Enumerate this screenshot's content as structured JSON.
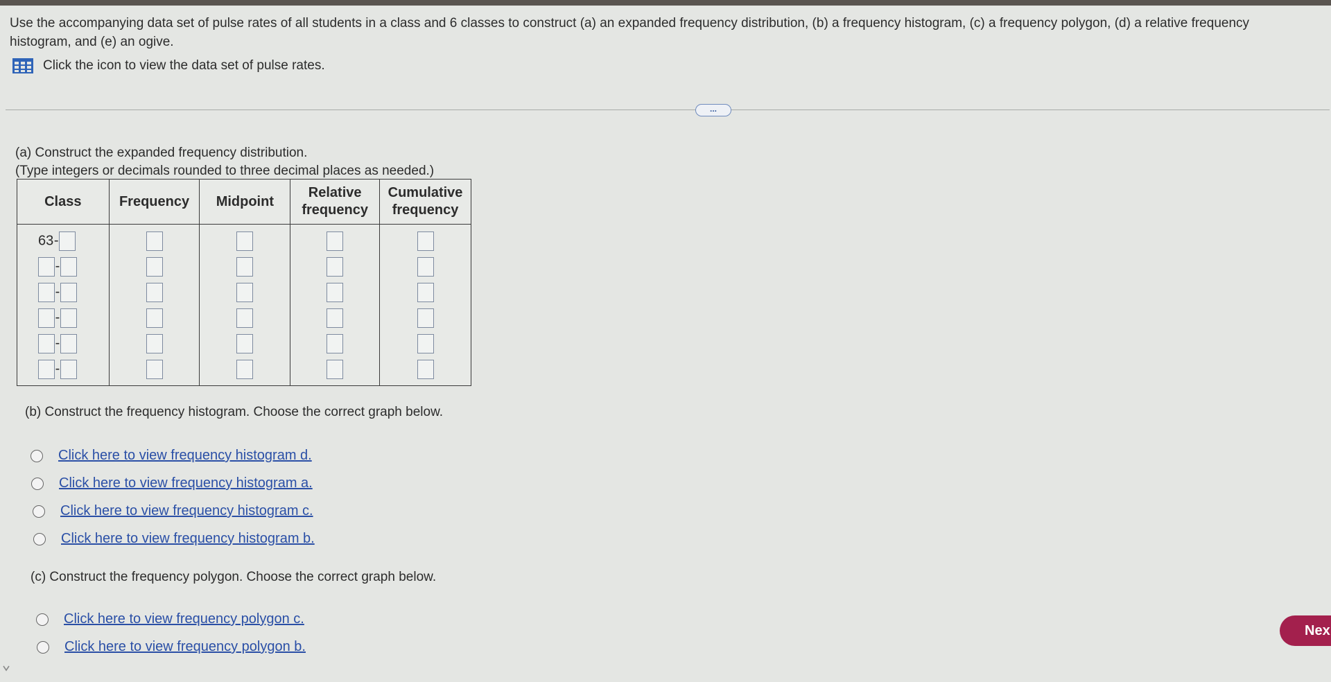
{
  "question": {
    "text": "Use the accompanying data set of pulse rates of all students in a class and 6 classes to construct (a) an expanded frequency distribution, (b) a frequency histogram, (c) a frequency polygon, (d) a relative frequency histogram, and (e) an ogive.",
    "data_link_label": "Click the icon to view the data set of pulse rates."
  },
  "more_button_label": "...",
  "part_a": {
    "title": "(a) Construct the expanded frequency distribution.",
    "instruction": "(Type integers or decimals rounded to three decimal places as needed.)",
    "headers": {
      "class": "Class",
      "frequency": "Frequency",
      "midpoint": "Midpoint",
      "relative_1": "Relative",
      "relative_2": "frequency",
      "cumulative_1": "Cumulative",
      "cumulative_2": "frequency"
    },
    "first_lower_limit": "63",
    "dash": "-"
  },
  "part_b": {
    "title": "(b) Construct the frequency histogram. Choose the correct graph below.",
    "options": [
      "Click here to view frequency histogram d.",
      "Click here to view frequency histogram a.",
      "Click here to view frequency histogram c.",
      "Click here to view frequency histogram b."
    ]
  },
  "part_c": {
    "title": "(c) Construct the frequency polygon. Choose the correct graph below.",
    "options": [
      "Click here to view frequency polygon c.",
      "Click here to view frequency polygon b."
    ]
  },
  "next_button_label": "Nex",
  "icons": {
    "data_table": "grid-table-icon",
    "scroll": "chevron-down-icon"
  },
  "colors": {
    "link": "#2a4fa6",
    "next_button": "#a3204d",
    "icon_blue": "#2f64b8"
  }
}
